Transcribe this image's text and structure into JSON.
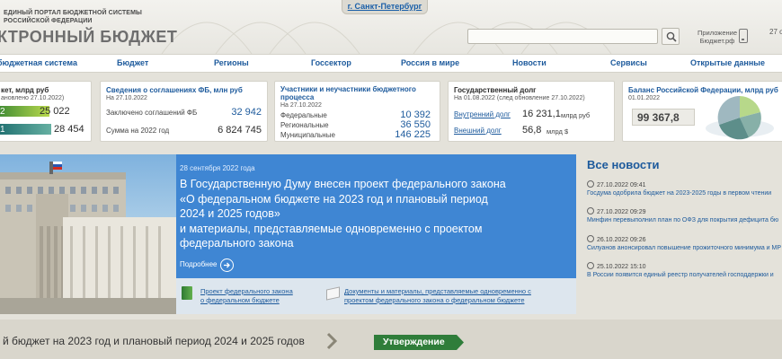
{
  "header": {
    "portal_line1": "ЕДИНЫЙ ПОРТАЛ БЮДЖЕТНОЙ СИСТЕМЫ",
    "portal_line2": "РОССИЙСКОЙ ФЕДЕРАЦИИ",
    "brand": "КТРОННЫЙ БЮДЖЕТ",
    "city": "г. Санкт-Петербург",
    "search_icon": "search-icon",
    "app_label": "Приложение Бюджет.рф",
    "app_icon": "phone-icon",
    "date": "27 о"
  },
  "nav": {
    "items": [
      "бюджетная система",
      "Бюджет",
      "Регионы",
      "Госсектор",
      "Россия в мире",
      "Новости",
      "Сервисы",
      "Открытые данные"
    ]
  },
  "cards": {
    "budget": {
      "title": "кет, млрд руб",
      "subtitle": "ановлено 27.10.2022)",
      "row1_left": "2",
      "row1_value": "25 022",
      "row2_left": "1",
      "row2_value": "28 454"
    },
    "agreements": {
      "title": "Сведения о соглашениях ФБ, млн руб",
      "subtitle": "На 27.10.2022",
      "row1_label": "Заключено соглашений ФБ",
      "row1_value": "32 942",
      "row2_label": "Сумма на 2022 год",
      "row2_value": "6 824 745"
    },
    "participants": {
      "title_line1": "Участники и неучастники бюджетного",
      "title_line2": "процесса",
      "subtitle": "На 27.10.2022",
      "rows": [
        {
          "label": "Федеральные",
          "value": "10 392"
        },
        {
          "label": "Региональные",
          "value": "36 550"
        },
        {
          "label": "Муниципальные",
          "value": "146 225"
        }
      ]
    },
    "debt": {
      "title": "Государственный долг",
      "subtitle": "На 01.08.2022 (след обновление 27.10.2022)",
      "internal_label": "Внутренний долг",
      "internal_value": "16 231,1",
      "internal_unit": "млрд руб",
      "external_label": "Внешний долг",
      "external_value": "56,8",
      "external_unit": "млрд $"
    },
    "balance": {
      "title": "Баланс Российской Федерации, млрд руб",
      "subtitle": "01.01.2022",
      "value": "99 367,8"
    }
  },
  "banner": {
    "date": "28 сентября 2022 года",
    "headline": [
      "В Государственную Думу внесен проект федерального закона",
      "«О федеральном бюджете на 2023 год и плановый период",
      "2024 и 2025 годов»",
      "и материалы, представляемые одновременно с проектом",
      "федерального закона"
    ],
    "more": "Подробнее",
    "doc1": [
      "Проект федерального закона",
      "о федеральном бюджете"
    ],
    "doc2": [
      "Документы и материалы, представляемые одновременно с",
      "проектом федерального закона о федеральном бюджете"
    ]
  },
  "news": {
    "title": "Все новости",
    "items": [
      {
        "time": "27.10.2022 09:41",
        "text": "Госдума одобрила бюджет на 2023-2025 годы в первом чтении"
      },
      {
        "time": "27.10.2022 09:29",
        "text": "Минфин перевыполнил план по ОФЗ для покрытия дефицита бю"
      },
      {
        "time": "26.10.2022 09:26",
        "text": "Силуанов анонсировал повышение прожиточного минимума и МР"
      },
      {
        "time": "25.10.2022 15:10",
        "text": "В России появится единый реестр получателей господдержки и"
      }
    ]
  },
  "bottom": {
    "text": "й бюджет на 2023 год и плановый период 2024 и 2025 годов",
    "stage": "Утверждение"
  },
  "colors": {
    "accent": "#1d5a9c",
    "banner": "#3f86d3",
    "approve": "#2f7d3a",
    "background": "#e4e2da"
  }
}
